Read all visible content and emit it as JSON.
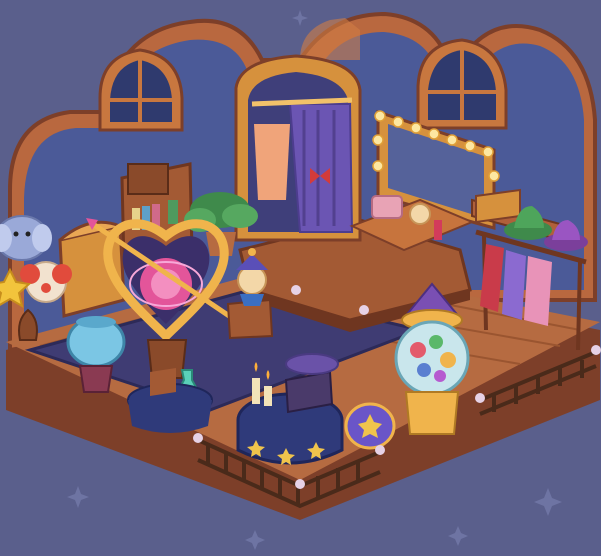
{
  "scene": {
    "kind": "isometric-room",
    "theme": "magic-circus-dressing-room",
    "colors": {
      "background": "#5a5f8c",
      "wall_frame": "#b9683f",
      "wall_glass": "#4b5a98",
      "floor_wood": "#b66b41",
      "floor_edge": "#7d3f29",
      "rug": "#3f3c73",
      "accent_pink": "#e3559a",
      "accent_gold": "#f0b44c"
    },
    "items": [
      "arched-window-left",
      "arched-window-center",
      "arched-window-right",
      "wardrobe-with-curtain",
      "vanity-mirror-with-bulbs",
      "hat-rack",
      "clothes-rack",
      "bookshelf",
      "potted-plant",
      "elephant-balloon",
      "clown-balloon",
      "star-balloon",
      "fish-bowl",
      "heart-magic-mirror",
      "jester-toy",
      "crystal-ball-lamp",
      "gumball-machine",
      "spellbook-table",
      "potion-bottle",
      "candles",
      "wooden-fence"
    ]
  }
}
